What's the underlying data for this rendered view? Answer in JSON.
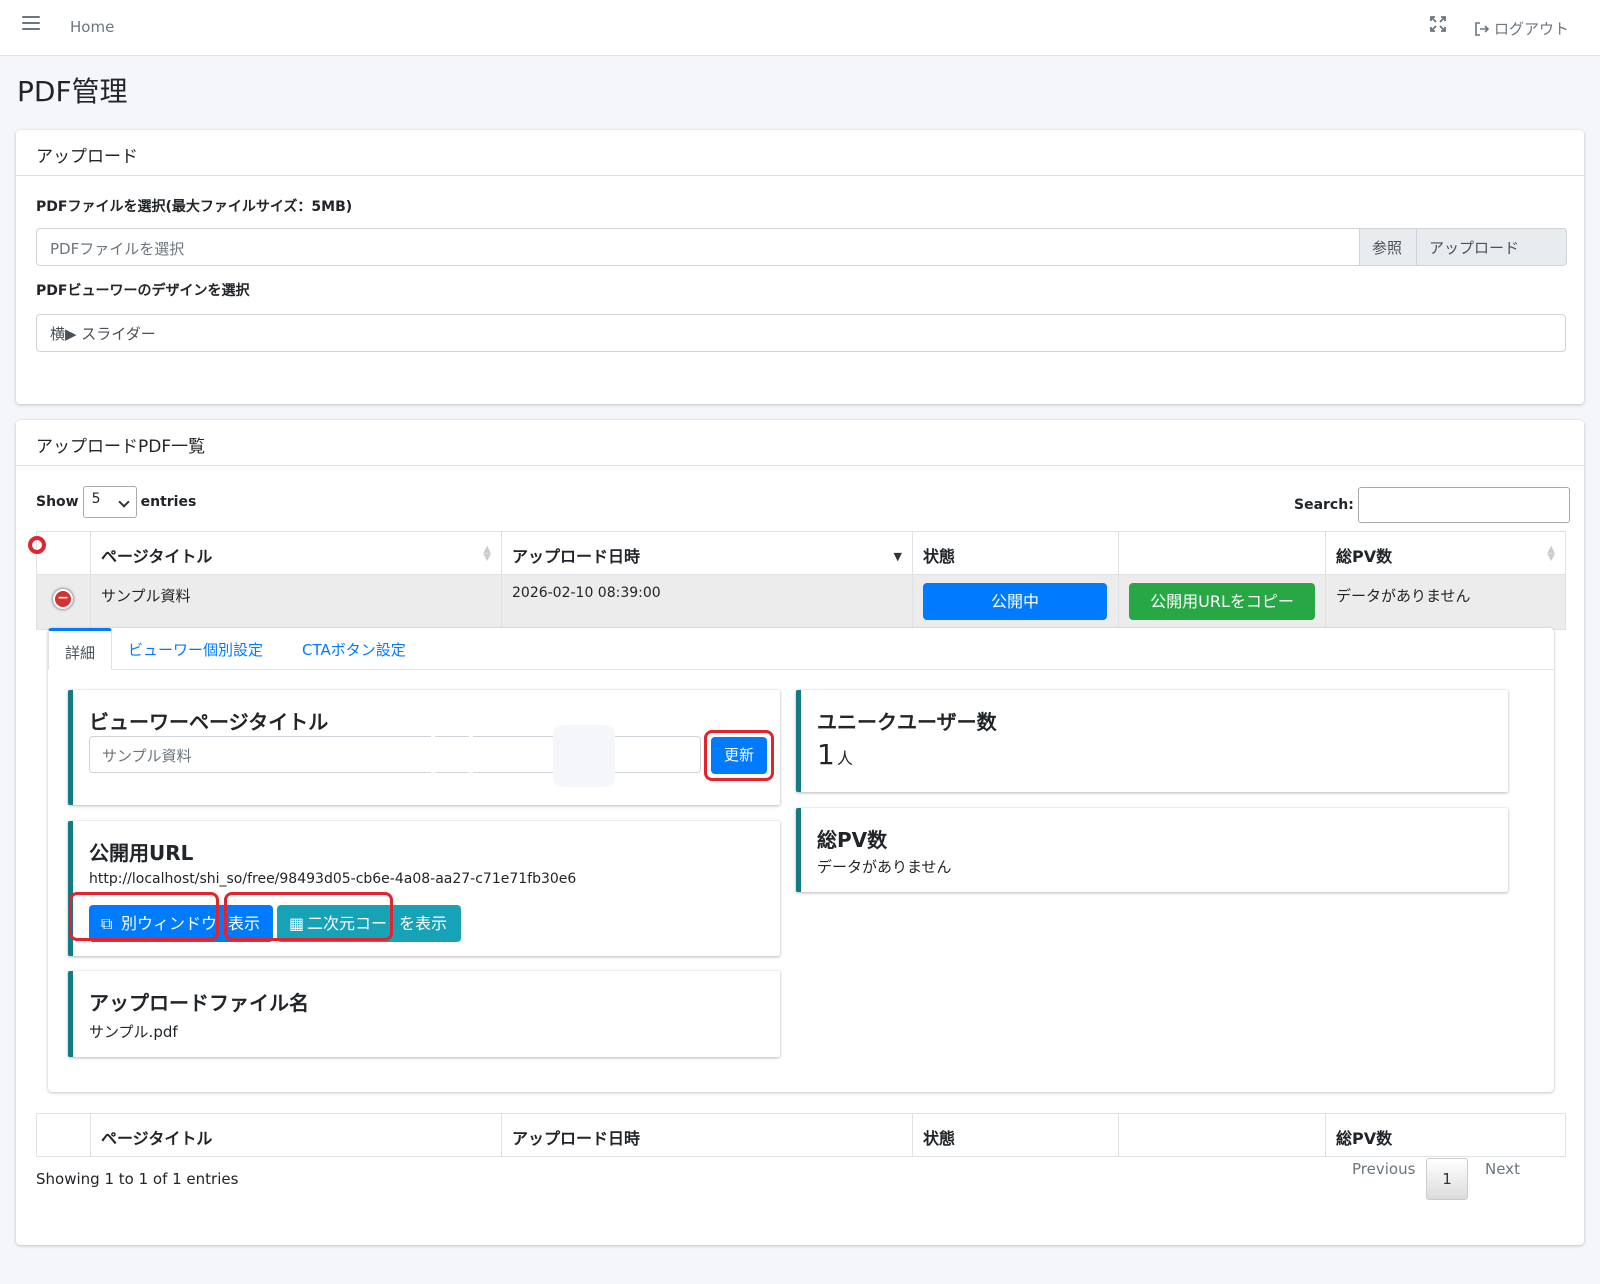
{
  "navbar": {
    "home": "Home",
    "logout": "ログアウト"
  },
  "page_title": "PDF管理",
  "upload": {
    "header": "アップロード",
    "file_label": "PDFファイルを選択(最大ファイルサイズ：5MB)",
    "file_placeholder": "PDFファイルを選択",
    "browse": "参照",
    "upload_btn": "アップロード",
    "design_label": "PDFビューワーのデザインを選択",
    "design_value": "横▶ スライダー"
  },
  "list": {
    "header": "アップロードPDF一覧",
    "show": "Show",
    "entries_value": "5",
    "entries": "entries",
    "search": "Search:",
    "columns": [
      "ページタイトル",
      "アップロード日時",
      "状態",
      "",
      "総PV数"
    ],
    "row": {
      "title": "サンプル資料",
      "date": "2026-02-10 08:39:00",
      "status_btn": "公開中",
      "copy_btn": "公開用URLをコピー",
      "pv": "データがありません"
    },
    "showing": "Showing 1 to 1 of 1 entries",
    "previous": "Previous",
    "page": "1",
    "next": "Next"
  },
  "detail": {
    "tabs": [
      "詳細",
      "ビューワー個別設定",
      "CTAボタン設定"
    ],
    "viewer_title_label": "ビューワーページタイトル",
    "viewer_title_value": "サンプル資料",
    "update_btn": "更新",
    "public_url_label": "公開用URL",
    "public_url": "http://localhost/shi_so/free/98493d05-cb6e-4a08-aa27-c71e71fb30e6",
    "open_window_btn_a": "別ウィンドウ",
    "open_window_btn_b": "表示",
    "qr_btn_a": "二次元コー",
    "qr_btn_b": "を表示",
    "file_name_label": "アップロードファイル名",
    "file_name": "サンプル.pdf",
    "unique_users_label": "ユニークユーザー数",
    "unique_users_value": "1",
    "unique_users_unit": "人",
    "total_pv_label": "総PV数",
    "total_pv_value": "データがありません"
  },
  "colors": {
    "primary": "#007bff",
    "success": "#28a745",
    "info": "#17a2b8",
    "teal_border": "#137a86",
    "highlight": "#e0252f"
  }
}
